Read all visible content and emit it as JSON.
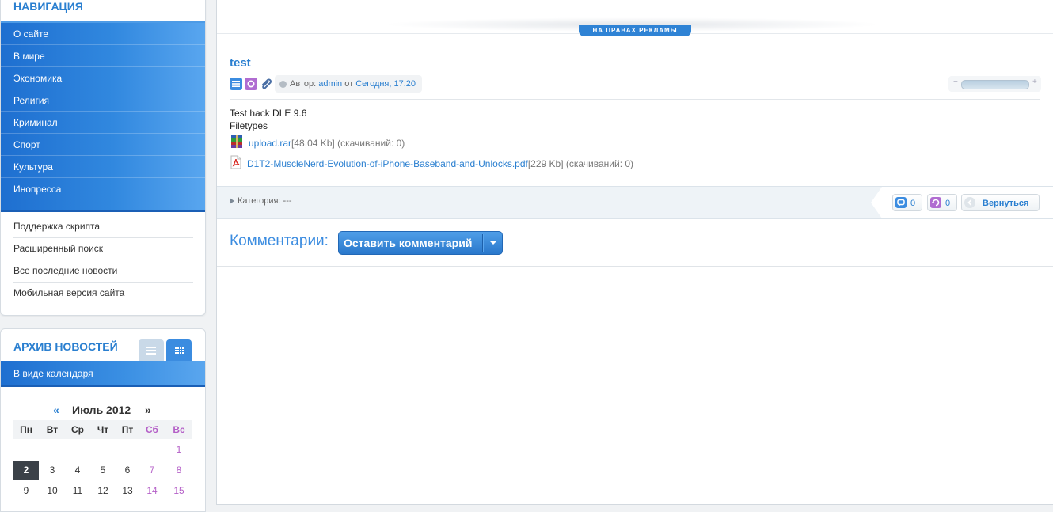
{
  "sidebar": {
    "nav_title": "НАВИГАЦИЯ",
    "nav_items": [
      "О сайте",
      "В мире",
      "Экономика",
      "Религия",
      "Криминал",
      "Спорт",
      "Культура",
      "Инопресса"
    ],
    "nav_links": [
      "Поддержка скрипта",
      "Расширенный поиск",
      "Все последние новости",
      "Мобильная версия сайта"
    ],
    "archive_title": "АРХИВ НОВОСТЕЙ",
    "archive_mode": "В виде календаря",
    "calendar": {
      "prev": "«",
      "title": "Июль 2012",
      "next": "»",
      "days_of_week": [
        "Пн",
        "Вт",
        "Ср",
        "Чт",
        "Пт",
        "Сб",
        "Вс"
      ],
      "rows": [
        [
          "",
          "",
          "",
          "",
          "",
          "",
          "1"
        ],
        [
          "2",
          "3",
          "4",
          "5",
          "6",
          "7",
          "8"
        ],
        [
          "9",
          "10",
          "11",
          "12",
          "13",
          "14",
          "15"
        ]
      ],
      "today": "2"
    }
  },
  "ad_badge": "НА ПРАВАХ РЕКЛАМЫ",
  "post": {
    "title": "test",
    "author_prefix": "Автор:",
    "author": "admin",
    "date_prefix": "от",
    "date": "Сегодня, 17:20",
    "rating_fraction": 0.0,
    "body_lines": [
      "Test hack DLE 9.6",
      "Filetypes"
    ],
    "attachments": [
      {
        "name": "upload.rar",
        "info": "[48,04 Kb] (скачиваний: 0)",
        "icon": "winrar-archive-icon"
      },
      {
        "name": "D1T2-MuscleNerd-Evolution-of-iPhone-Baseband-and-Unlocks.pdf",
        "info": "[229 Kb] (скачиваний: 0)",
        "icon": "pdf-file-icon"
      }
    ],
    "category_text": "Категория: ---",
    "comments_count": "0",
    "views_count": "0",
    "back_label": "Вернуться"
  },
  "comments": {
    "label": "Комментарии:",
    "button": "Оставить комментарий"
  },
  "colors": {
    "accent": "#2a7fd0",
    "nav_blue": "#2a7fd0",
    "purple": "#b06cd1",
    "weekend": "#b45fc7"
  }
}
